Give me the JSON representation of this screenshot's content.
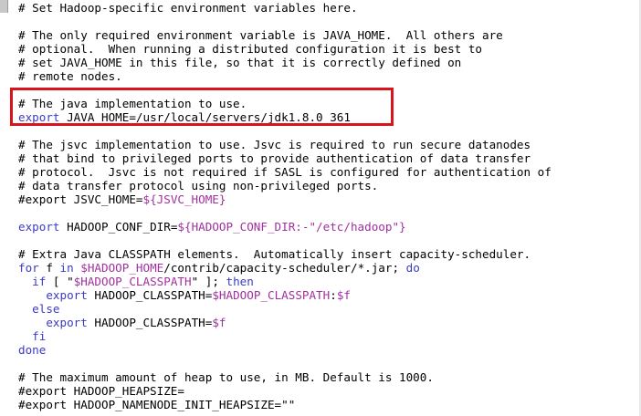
{
  "editor": {
    "lines": [
      [
        {
          "t": "# Set Hadoop-specific environment variables here."
        }
      ],
      [],
      [
        {
          "t": "# The only required environment variable is JAVA_HOME.  All others are"
        }
      ],
      [
        {
          "t": "# optional.  When running a distributed configuration it is best to"
        }
      ],
      [
        {
          "t": "# set JAVA_HOME in this file, so that it is correctly defined on"
        }
      ],
      [
        {
          "t": "# remote nodes."
        }
      ],
      [],
      [
        {
          "t": "# The java implementation to use."
        }
      ],
      [
        {
          "t": "export",
          "c": "kw"
        },
        {
          "t": " JAVA_HOME=/usr/local/servers/jdk1.8.0_361"
        }
      ],
      [],
      [
        {
          "t": "# The jsvc implementation to use. Jsvc is required to run secure datanodes"
        }
      ],
      [
        {
          "t": "# that bind to privileged ports to provide authentication of data transfer"
        }
      ],
      [
        {
          "t": "# protocol.  Jsvc is not required if SASL is configured for authentication of"
        }
      ],
      [
        {
          "t": "# data transfer protocol using non-privileged ports."
        }
      ],
      [
        {
          "t": "#export JSVC_HOME="
        },
        {
          "t": "${JSVC_HOME}",
          "c": "var"
        }
      ],
      [],
      [
        {
          "t": "export",
          "c": "kw"
        },
        {
          "t": " HADOOP_CONF_DIR="
        },
        {
          "t": "${HADOOP_CONF_DIR:-\"/etc/hadoop\"}",
          "c": "var"
        }
      ],
      [],
      [
        {
          "t": "# Extra Java CLASSPATH elements.  Automatically insert capacity-scheduler."
        }
      ],
      [
        {
          "t": "for",
          "c": "kw"
        },
        {
          "t": " f "
        },
        {
          "t": "in",
          "c": "kw"
        },
        {
          "t": " "
        },
        {
          "t": "$HADOOP_HOME",
          "c": "var"
        },
        {
          "t": "/contrib/capacity-scheduler/*.jar; "
        },
        {
          "t": "do",
          "c": "kw"
        }
      ],
      [
        {
          "t": "  "
        },
        {
          "t": "if",
          "c": "kw"
        },
        {
          "t": " [ \""
        },
        {
          "t": "$HADOOP_CLASSPATH",
          "c": "var"
        },
        {
          "t": "\" ]; "
        },
        {
          "t": "then",
          "c": "kw"
        }
      ],
      [
        {
          "t": "    "
        },
        {
          "t": "export",
          "c": "kw"
        },
        {
          "t": " HADOOP_CLASSPATH="
        },
        {
          "t": "$HADOOP_CLASSPATH",
          "c": "var"
        },
        {
          "t": ":"
        },
        {
          "t": "$f",
          "c": "var"
        }
      ],
      [
        {
          "t": "  "
        },
        {
          "t": "else",
          "c": "kw"
        }
      ],
      [
        {
          "t": "    "
        },
        {
          "t": "export",
          "c": "kw"
        },
        {
          "t": " HADOOP_CLASSPATH="
        },
        {
          "t": "$f",
          "c": "var"
        }
      ],
      [
        {
          "t": "  "
        },
        {
          "t": "fi",
          "c": "kw"
        }
      ],
      [
        {
          "t": "done",
          "c": "kw"
        }
      ],
      [],
      [
        {
          "t": "# The maximum amount of heap to use, in MB. Default is 1000."
        }
      ],
      [
        {
          "t": "#export HADOOP_HEAPSIZE="
        }
      ],
      [
        {
          "t": "#export HADOOP_NAMENODE_INIT_HEAPSIZE=\"\""
        }
      ]
    ]
  },
  "colors": {
    "keyword": "#3b3bc2",
    "variable": "#a0309f",
    "text": "#000000",
    "highlight_border": "#d9141b"
  }
}
